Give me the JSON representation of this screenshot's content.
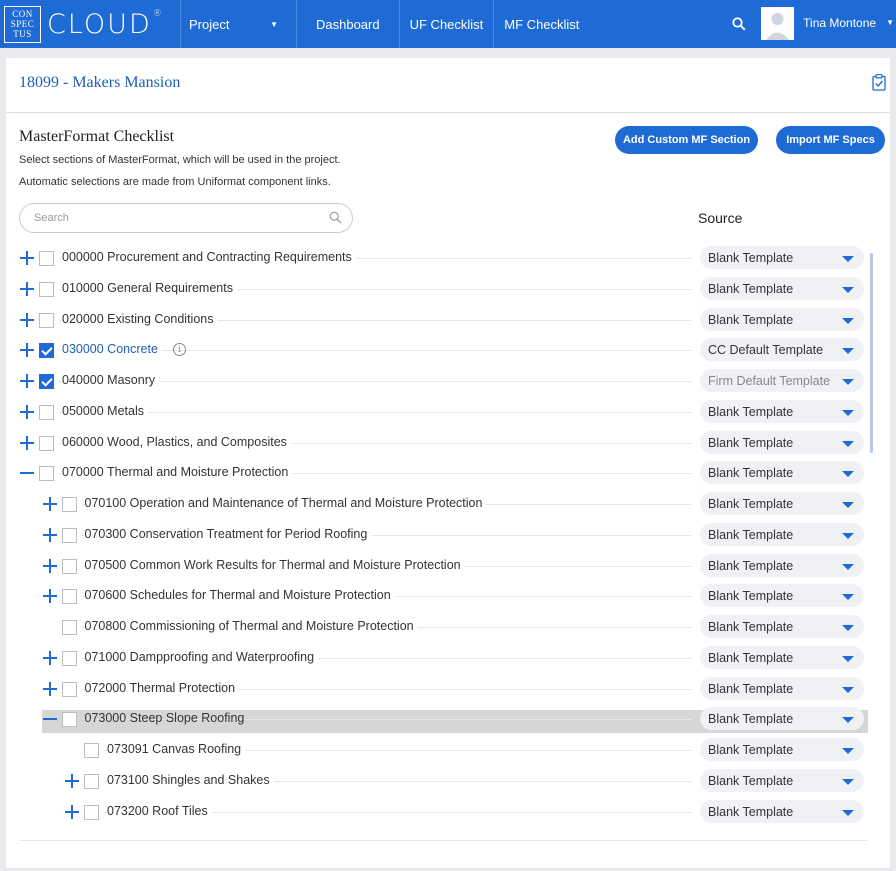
{
  "topbar": {
    "logo_box_lines": [
      "CON",
      "SPEC",
      "TUS"
    ],
    "logo_text": "CLOUD",
    "logo_reg": "®",
    "project_label": "Project",
    "nav": [
      "Dashboard",
      "UF Checklist",
      "MF Checklist"
    ],
    "user_name": "Tina Montone",
    "color_bg": "#1e6bd6"
  },
  "project_title": "18099 - Makers Mansion",
  "section": {
    "title": "MasterFormat Checklist",
    "desc1": "Select sections of MasterFormat, which will be used in the project.",
    "desc2": "Automatic selections are made from Uniformat component links.",
    "add_button": "Add Custom MF Section",
    "import_button": "Import MF Specs",
    "search_placeholder": "Search",
    "source_header": "Source"
  },
  "rows": [
    {
      "level": 0,
      "toggle": "plus",
      "checked": false,
      "label": "000000 Procurement and Contracting Requirements",
      "source": "Blank Template"
    },
    {
      "level": 0,
      "toggle": "plus",
      "checked": false,
      "label": "010000 General Requirements",
      "source": "Blank Template"
    },
    {
      "level": 0,
      "toggle": "plus",
      "checked": false,
      "label": "020000 Existing Conditions",
      "source": "Blank Template"
    },
    {
      "level": 0,
      "toggle": "plus",
      "checked": true,
      "label": "030000 Concrete",
      "source": "CC Default Template",
      "blue": true,
      "info": true
    },
    {
      "level": 0,
      "toggle": "plus",
      "checked": true,
      "label": "040000 Masonry",
      "source": "Firm Default Template",
      "muted": true
    },
    {
      "level": 0,
      "toggle": "plus",
      "checked": false,
      "label": "050000 Metals",
      "source": "Blank Template"
    },
    {
      "level": 0,
      "toggle": "plus",
      "checked": false,
      "label": "060000 Wood, Plastics, and Composites",
      "source": "Blank Template"
    },
    {
      "level": 0,
      "toggle": "minus",
      "checked": false,
      "label": "070000 Thermal and Moisture Protection",
      "source": "Blank Template"
    },
    {
      "level": 1,
      "toggle": "plus",
      "checked": false,
      "label": "070100 Operation and Maintenance of Thermal and Moisture Protection",
      "source": "Blank Template"
    },
    {
      "level": 1,
      "toggle": "plus",
      "checked": false,
      "label": "070300 Conservation Treatment for Period Roofing",
      "source": "Blank Template"
    },
    {
      "level": 1,
      "toggle": "plus",
      "checked": false,
      "label": "070500 Common Work Results for Thermal and Moisture Protection",
      "source": "Blank Template"
    },
    {
      "level": 1,
      "toggle": "plus",
      "checked": false,
      "label": "070600 Schedules for Thermal and Moisture Protection",
      "source": "Blank Template"
    },
    {
      "level": 1,
      "toggle": "none",
      "checked": false,
      "label": "070800 Commissioning of Thermal and Moisture Protection",
      "source": "Blank Template"
    },
    {
      "level": 1,
      "toggle": "plus",
      "checked": false,
      "label": "071000 Dampproofing and Waterproofing",
      "source": "Blank Template"
    },
    {
      "level": 1,
      "toggle": "plus",
      "checked": false,
      "label": "072000 Thermal Protection",
      "source": "Blank Template"
    },
    {
      "level": 1,
      "toggle": "minus",
      "checked": false,
      "label": "073000 Steep Slope Roofing",
      "source": "Blank Template",
      "highlight": true
    },
    {
      "level": 2,
      "toggle": "none",
      "checked": false,
      "label": "073091 Canvas Roofing",
      "source": "Blank Template"
    },
    {
      "level": 2,
      "toggle": "plus",
      "checked": false,
      "label": "073100 Shingles and Shakes",
      "source": "Blank Template"
    },
    {
      "level": 2,
      "toggle": "plus",
      "checked": false,
      "label": "073200 Roof Tiles",
      "source": "Blank Template"
    }
  ]
}
